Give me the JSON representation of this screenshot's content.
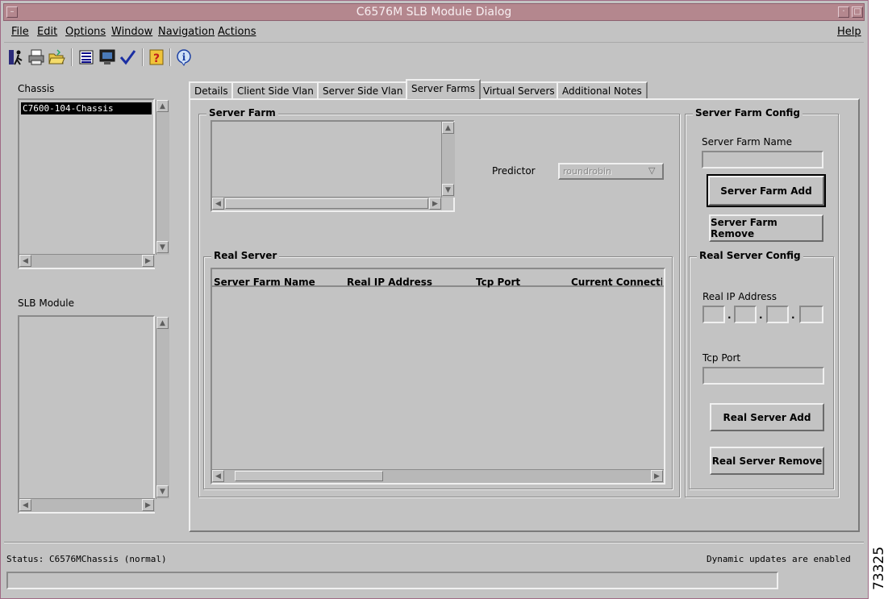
{
  "window": {
    "title": "C6576M SLB Module Dialog"
  },
  "menubar": {
    "file": "File",
    "edit": "Edit",
    "options": "Options",
    "window": "Window",
    "navigation": "Navigation",
    "actions": "Actions",
    "help": "Help"
  },
  "toolbar": {
    "icons": [
      "exit-icon",
      "printer-icon",
      "open-folder-icon",
      "list-icon",
      "monitor-icon",
      "checkmark-icon",
      "help-question-icon",
      "info-icon"
    ]
  },
  "left": {
    "chassis_label": "Chassis",
    "chassis_items": [
      "C7600-104-Chassis"
    ],
    "slb_module_label": "SLB Module"
  },
  "tabs": [
    {
      "label": "Details"
    },
    {
      "label": "Client Side Vlan"
    },
    {
      "label": "Server Side Vlan"
    },
    {
      "label": "Server Farms",
      "active": true
    },
    {
      "label": "Virtual Servers"
    },
    {
      "label": "Additional Notes"
    }
  ],
  "server_farm": {
    "group_title": "Server Farm",
    "predictor_label": "Predictor",
    "predictor_value": "roundrobin"
  },
  "real_server": {
    "group_title": "Real Server",
    "columns": [
      "Server Farm Name",
      "Real IP Address",
      "Tcp Port",
      "Current Connections"
    ]
  },
  "server_farm_config": {
    "group_title": "Server Farm Config",
    "name_label": "Server Farm Name",
    "name_value": "",
    "add_button": "Server Farm Add",
    "remove_button": "Server Farm Remove"
  },
  "real_server_config": {
    "group_title": "Real Server Config",
    "ip_label": "Real IP Address",
    "tcp_port_label": "Tcp Port",
    "add_button": "Real Server Add",
    "remove_button": "Real Server Remove"
  },
  "status": {
    "text": "Status: C6576MChassis (normal)",
    "updates": "Dynamic updates are enabled"
  },
  "figure_id": "73325"
}
